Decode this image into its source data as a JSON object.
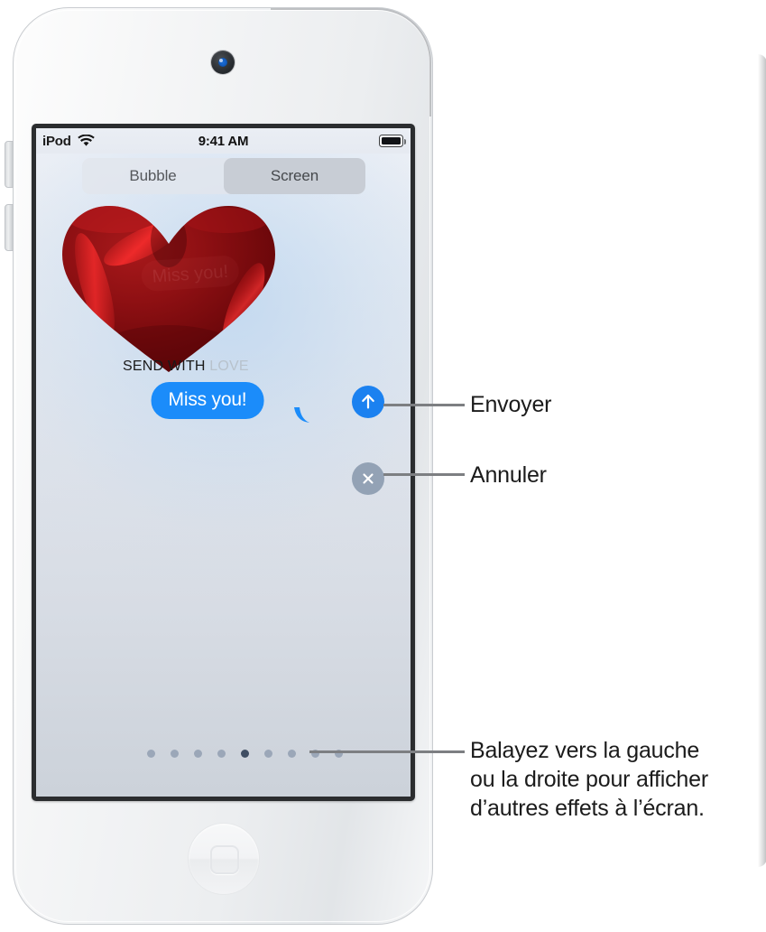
{
  "device": {
    "name": "iPod touch",
    "camera_icon": "front-camera-icon",
    "home_button_icon": "home-button-icon",
    "volume_up_icon": "volume-up-button",
    "volume_down_icon": "volume-down-button"
  },
  "status_bar": {
    "carrier": "iPod",
    "wifi_icon": "wifi-icon",
    "time": "9:41 AM",
    "battery_icon": "battery-full-icon"
  },
  "segmented_control": {
    "options": [
      {
        "label": "Bubble",
        "selected": false
      },
      {
        "label": "Screen",
        "selected": true
      }
    ]
  },
  "effect": {
    "name": "send-with-love-heart-effect",
    "heart_icon": "red-heart-balloon-icon",
    "caption_dark": "SEND WITH ",
    "caption_light": "LOVE",
    "ghost_text": "Miss you!"
  },
  "message": {
    "text": "Miss you!",
    "bubble_color": "#1b8cfa",
    "text_color": "#ffffff"
  },
  "actions": {
    "send": {
      "icon": "arrow-up-icon",
      "color": "#1b81f0"
    },
    "cancel": {
      "icon": "close-x-icon",
      "color": "#93a2b5"
    }
  },
  "page_dots": {
    "count": 9,
    "active_index": 4,
    "inactive_color": "#9ba7b8",
    "active_color": "#3f4e63"
  },
  "callouts": [
    {
      "id": "send",
      "label": "Envoyer"
    },
    {
      "id": "cancel",
      "label": "Annuler"
    },
    {
      "id": "swipe",
      "label": "Balayez vers la gauche\nou la droite pour afficher\nd’autres effets à l’écran."
    }
  ]
}
